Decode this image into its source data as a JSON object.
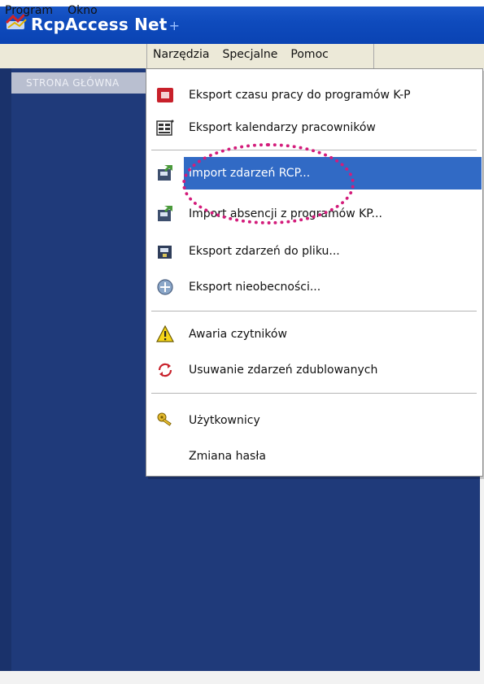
{
  "window": {
    "title": "RcpAccess Net",
    "title_suffix": "+"
  },
  "menubar": {
    "items": [
      {
        "label": "Program"
      },
      {
        "label": "Okno"
      },
      {
        "label": "Narzędzia"
      },
      {
        "label": "Specjalne"
      },
      {
        "label": "Pomoc"
      }
    ]
  },
  "tab": {
    "label": "STRONA GŁÓWNA"
  },
  "dropdown": {
    "items": [
      {
        "label": "Eksport czasu pracy do programów K-P",
        "icon": "export-red-icon"
      },
      {
        "label": "Eksport kalendarzy pracowników",
        "icon": "calendar-export-icon"
      },
      {
        "label": "Import zdarzeń RCP...",
        "icon": "import-events-icon",
        "selected": true
      },
      {
        "label": "Import absencji z programów KP...",
        "icon": "import-absence-icon"
      },
      {
        "label": "Eksport zdarzeń do pliku...",
        "icon": "export-file-icon"
      },
      {
        "label": "Eksport nieobecności...",
        "icon": "export-absence-icon"
      },
      {
        "label": "Awaria czytników",
        "icon": "warning-icon"
      },
      {
        "label": "Usuwanie zdarzeń zdublowanych",
        "icon": "remove-duplicates-icon"
      },
      {
        "label": "Użytkownicy",
        "icon": "users-key-icon"
      },
      {
        "label": "Zmiana hasła",
        "icon": ""
      }
    ]
  },
  "colors": {
    "titlebar": "#0f4bbd",
    "menubar": "#ece9d8",
    "workspace": "#1f3a7a",
    "selection": "#316ac5",
    "annotation": "#d31c7b"
  }
}
